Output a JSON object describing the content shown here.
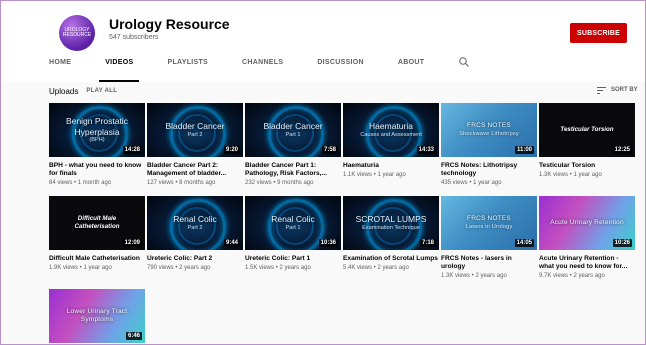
{
  "channel": {
    "name": "Urology Resource",
    "subscribers": "547 subscribers",
    "avatar_text": "UROLOGY RESOURCE",
    "subscribe_label": "SUBSCRIBE",
    "subscribe_color": "#cc0000"
  },
  "tabs": [
    {
      "label": "HOME"
    },
    {
      "label": "VIDEOS"
    },
    {
      "label": "PLAYLISTS"
    },
    {
      "label": "CHANNELS"
    },
    {
      "label": "DISCUSSION"
    },
    {
      "label": "ABOUT"
    }
  ],
  "active_tab": "VIDEOS",
  "uploads": {
    "title": "Uploads",
    "play_all": "PLAY ALL",
    "sort": "SORT BY"
  },
  "videos": [
    {
      "thumb_style": "dark",
      "thumb_line1": "Benign Prostatic Hyperplasia",
      "thumb_line2": "(BPH)",
      "duration": "14:28",
      "title": "BPH - what you need to know for finals",
      "meta": "84 views • 1 month ago"
    },
    {
      "thumb_style": "dark",
      "thumb_line1": "Bladder Cancer",
      "thumb_line2": "Part 2",
      "duration": "9:20",
      "title": "Bladder Cancer Part 2: Management of bladder...",
      "meta": "127 views • 8 months ago"
    },
    {
      "thumb_style": "dark",
      "thumb_line1": "Bladder Cancer",
      "thumb_line2": "Part 1",
      "duration": "7:58",
      "title": "Bladder Cancer Part 1: Pathology, Risk Factors,...",
      "meta": "232 views • 9 months ago"
    },
    {
      "thumb_style": "dark",
      "thumb_line1": "Haematuria",
      "thumb_line2": "Causes and Assessment",
      "duration": "14:33",
      "title": "Haematuria",
      "meta": "1.1K views • 1 year ago"
    },
    {
      "thumb_style": "blue",
      "thumb_line1": "FRCS NOTES",
      "thumb_line2": "Shockwave Lithotripsy",
      "duration": "11:00",
      "title": "FRCS Notes: Lithotripsy technology",
      "meta": "435 views • 1 year ago"
    },
    {
      "thumb_style": "black",
      "thumb_line1": "Testicular Torsion",
      "thumb_line2": "",
      "duration": "12:25",
      "title": "Testicular Torsion",
      "meta": "1.3K views • 1 year ago"
    },
    {
      "thumb_style": "black",
      "thumb_line1": "Difficult Male Catheterisation",
      "thumb_line2": "",
      "duration": "12:09",
      "title": "Difficult Male Catheterisation",
      "meta": "1.9K views • 1 year ago"
    },
    {
      "thumb_style": "dark",
      "thumb_line1": "Renal Colic",
      "thumb_line2": "Part 2",
      "duration": "9:44",
      "title": "Ureteric Colic: Part 2",
      "meta": "790 views • 2 years ago"
    },
    {
      "thumb_style": "dark",
      "thumb_line1": "Renal Colic",
      "thumb_line2": "Part 1",
      "duration": "10:36",
      "title": "Ureteric Colic: Part 1",
      "meta": "1.5K views • 2 years ago"
    },
    {
      "thumb_style": "dark",
      "thumb_line1": "SCROTAL LUMPS",
      "thumb_line2": "Examination Technique",
      "duration": "7:18",
      "title": "Examination of Scrotal Lumps",
      "meta": "5.4K views • 2 years ago"
    },
    {
      "thumb_style": "blue",
      "thumb_line1": "FRCS NOTES",
      "thumb_line2": "Lasers in Urology",
      "duration": "14:05",
      "title": "FRCS Notes - lasers in urology",
      "meta": "1.3K views • 2 years ago"
    },
    {
      "thumb_style": "purple",
      "thumb_line1": "Acute Urinary Retention",
      "thumb_line2": "",
      "duration": "10:26",
      "title": "Acute Urinary Retention - what you need to know for...",
      "meta": "9.7K views • 2 years ago"
    },
    {
      "thumb_style": "purple",
      "thumb_line1": "Lower Urinary Tract Symptoms",
      "thumb_line2": "",
      "duration": "6:46",
      "title": "",
      "meta": ""
    }
  ]
}
